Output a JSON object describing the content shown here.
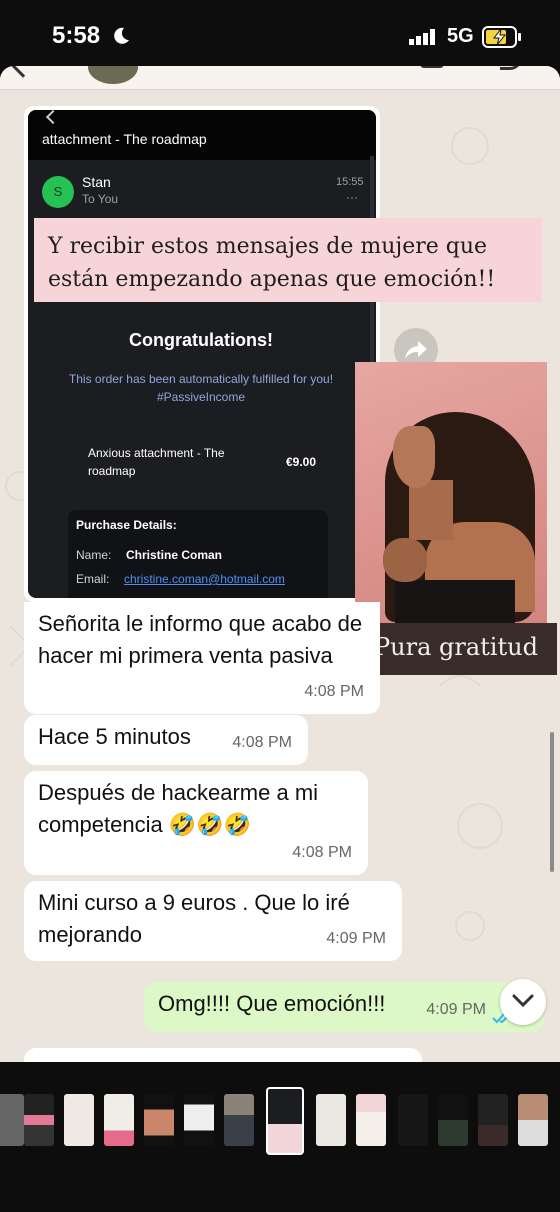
{
  "status": {
    "time": "5:58",
    "network": "5G"
  },
  "story": {
    "caption": "Y recibir estos mensajes de mujere que están empezando apenas que emoción!!",
    "photo_caption": "Pura gratitud"
  },
  "screenshot": {
    "title": "attachment - The roadmap",
    "sender_initial": "S",
    "sender": "Stan",
    "recipient": "To You",
    "time": "15:55",
    "menu": "···",
    "heading": "Congratulations!",
    "sub_line1": "This order has been automatically fulfilled for you!",
    "sub_line2": "#PassiveIncome",
    "product_line1": "Anxious attachment - The",
    "product_line2": "roadmap",
    "price": "€9.00",
    "details_heading": "Purchase Details:",
    "name_label": "Name:",
    "name_value": "Christine Coman",
    "email_label": "Email:",
    "email_value": "christine.coman@hotmail.com"
  },
  "messages": [
    {
      "text": "Señorita le informo que acabo de hacer mi primera venta pasiva",
      "time": "4:08 PM"
    },
    {
      "text": "Hace 5 minutos",
      "time": "4:08 PM"
    },
    {
      "text": "Después de hackearme a mi competencia 🤣🤣🤣",
      "time": "4:08 PM"
    },
    {
      "text": "Mini curso a 9 euros . Que lo iré mejorando",
      "time": "4:09 PM"
    },
    {
      "text": "Omg!!!! Que emoción!!!",
      "time": "4:09 PM",
      "outgoing": true
    }
  ],
  "colors": {
    "chat_bg": "#ece5dd",
    "incoming": "#ffffff",
    "outgoing": "#dcf8c6",
    "caption_bg": "#f6d4d8",
    "tick_blue": "#34b7f1"
  },
  "icons": [
    "moon-icon",
    "signal-icon",
    "battery-charging-icon",
    "forward-icon",
    "chevron-down-icon",
    "double-check-icon"
  ]
}
